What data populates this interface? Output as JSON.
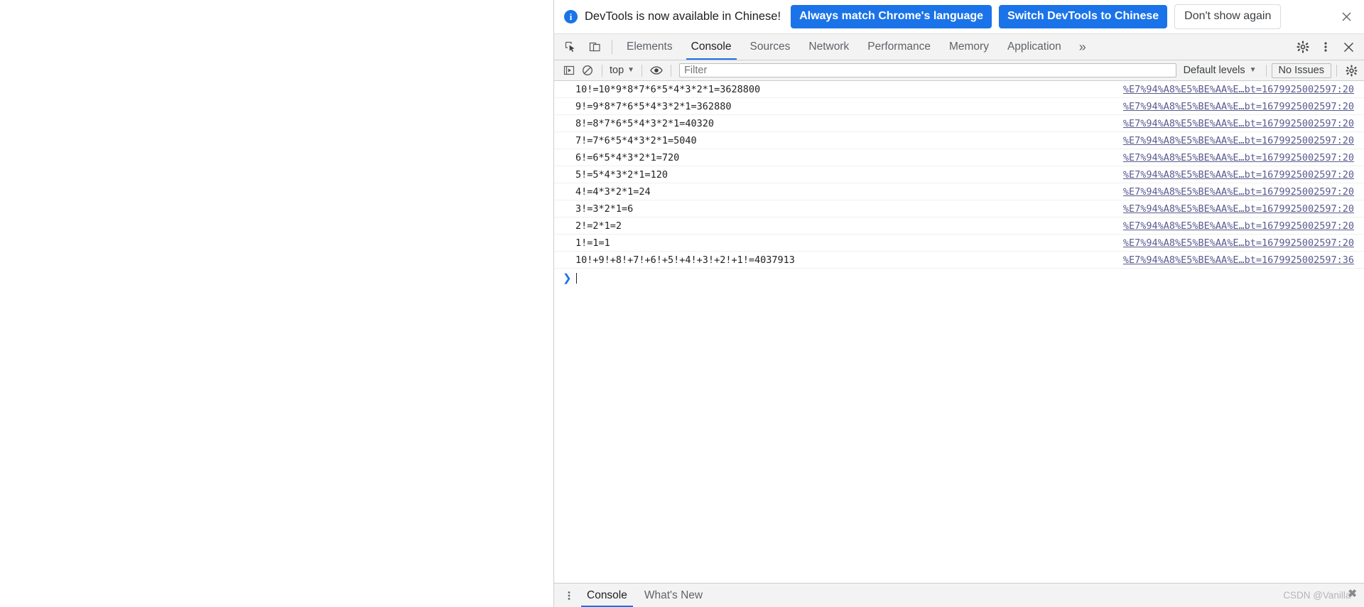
{
  "infobar": {
    "icon": "info-icon",
    "message": "DevTools is now available in Chinese!",
    "primary_button_1": "Always match Chrome's language",
    "primary_button_2": "Switch DevTools to Chinese",
    "secondary_button": "Don't show again",
    "close_icon": "close-icon",
    "accent_color": "#1a73e8"
  },
  "tabbar": {
    "inspect_icon": "inspect-element-icon",
    "device_icon": "device-toolbar-icon",
    "tabs": [
      {
        "label": "Elements",
        "active": false
      },
      {
        "label": "Console",
        "active": true
      },
      {
        "label": "Sources",
        "active": false
      },
      {
        "label": "Network",
        "active": false
      },
      {
        "label": "Performance",
        "active": false
      },
      {
        "label": "Memory",
        "active": false
      },
      {
        "label": "Application",
        "active": false
      }
    ],
    "more_tabs": "»",
    "settings_icon": "gear-icon",
    "more_options_icon": "kebab-menu-icon",
    "close_icon": "close-devtools-icon",
    "active_underline_color": "#1a73e8"
  },
  "console_toolbar": {
    "clear_console_icon": "clear-console-icon",
    "no_entry_icon": "no-entry-icon",
    "context_selector": "top",
    "context_caret": "▼",
    "eye_icon": "live-expression-icon",
    "filter_placeholder": "Filter",
    "filter_value": "",
    "levels_label": "Default levels",
    "levels_caret": "▼",
    "issues_label": "No Issues",
    "settings_icon": "console-settings-icon"
  },
  "console": {
    "rows": [
      {
        "text": "10!=10*9*8*7*6*5*4*3*2*1=3628800",
        "source": "%E7%94%A8%E5%BE%AA%E…bt=1679925002597:20"
      },
      {
        "text": "9!=9*8*7*6*5*4*3*2*1=362880",
        "source": "%E7%94%A8%E5%BE%AA%E…bt=1679925002597:20"
      },
      {
        "text": "8!=8*7*6*5*4*3*2*1=40320",
        "source": "%E7%94%A8%E5%BE%AA%E…bt=1679925002597:20"
      },
      {
        "text": "7!=7*6*5*4*3*2*1=5040",
        "source": "%E7%94%A8%E5%BE%AA%E…bt=1679925002597:20"
      },
      {
        "text": "6!=6*5*4*3*2*1=720",
        "source": "%E7%94%A8%E5%BE%AA%E…bt=1679925002597:20"
      },
      {
        "text": "5!=5*4*3*2*1=120",
        "source": "%E7%94%A8%E5%BE%AA%E…bt=1679925002597:20"
      },
      {
        "text": "4!=4*3*2*1=24",
        "source": "%E7%94%A8%E5%BE%AA%E…bt=1679925002597:20"
      },
      {
        "text": "3!=3*2*1=6",
        "source": "%E7%94%A8%E5%BE%AA%E…bt=1679925002597:20"
      },
      {
        "text": "2!=2*1=2",
        "source": "%E7%94%A8%E5%BE%AA%E…bt=1679925002597:20"
      },
      {
        "text": "1!=1=1",
        "source": "%E7%94%A8%E5%BE%AA%E…bt=1679925002597:20"
      },
      {
        "text": "10!+9!+8!+7!+6!+5!+4!+3!+2!+1!=4037913",
        "source": "%E7%94%A8%E5%BE%AA%E…bt=1679925002597:36"
      }
    ],
    "prompt_arrow": "❯",
    "prompt_value": ""
  },
  "drawer": {
    "menu_icon": "kebab-menu-icon",
    "tabs": [
      {
        "label": "Console",
        "active": true
      },
      {
        "label": "What's New",
        "active": false
      }
    ]
  },
  "watermark": {
    "text": "CSDN @Vanilla",
    "mark": "✖"
  }
}
